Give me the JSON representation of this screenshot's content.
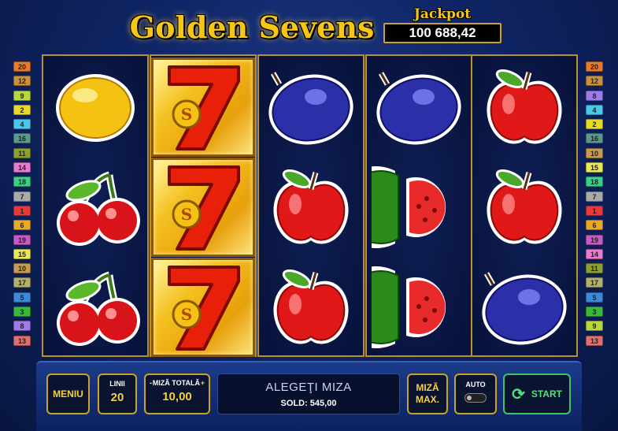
{
  "header": {
    "title": "Golden Sevens",
    "jackpot_label": "Jackpot",
    "jackpot_value": "100 688,42"
  },
  "paylines": {
    "left": [
      {
        "n": "20",
        "color": "#e87a2a"
      },
      {
        "n": "12",
        "color": "#c99040"
      },
      {
        "n": "9",
        "color": "#b7d83a"
      },
      {
        "n": "2",
        "color": "#e8d82a"
      },
      {
        "n": "4",
        "color": "#4ac8e8"
      },
      {
        "n": "16",
        "color": "#5a9a8a"
      },
      {
        "n": "11",
        "color": "#8aa030"
      },
      {
        "n": "14",
        "color": "#e87ad0"
      },
      {
        "n": "18",
        "color": "#3ad08a"
      },
      {
        "n": "7",
        "color": "#aaaaaa"
      },
      {
        "n": "1",
        "color": "#e83a3a"
      },
      {
        "n": "6",
        "color": "#e8a82a"
      },
      {
        "n": "19",
        "color": "#c85ac8"
      },
      {
        "n": "15",
        "color": "#e8e85a"
      },
      {
        "n": "10",
        "color": "#c89a50"
      },
      {
        "n": "17",
        "color": "#b0b070"
      },
      {
        "n": "5",
        "color": "#3a8ad8"
      },
      {
        "n": "3",
        "color": "#3ab83a"
      },
      {
        "n": "8",
        "color": "#a07ae8"
      },
      {
        "n": "13",
        "color": "#e07070"
      }
    ],
    "right": [
      {
        "n": "20",
        "color": "#e87a2a"
      },
      {
        "n": "12",
        "color": "#c99040"
      },
      {
        "n": "8",
        "color": "#a07ae8"
      },
      {
        "n": "4",
        "color": "#4ac8e8"
      },
      {
        "n": "2",
        "color": "#e8d82a"
      },
      {
        "n": "16",
        "color": "#5a9a8a"
      },
      {
        "n": "10",
        "color": "#c89a50"
      },
      {
        "n": "15",
        "color": "#e8e85a"
      },
      {
        "n": "18",
        "color": "#3ad08a"
      },
      {
        "n": "7",
        "color": "#aaaaaa"
      },
      {
        "n": "1",
        "color": "#e83a3a"
      },
      {
        "n": "6",
        "color": "#e8a82a"
      },
      {
        "n": "19",
        "color": "#c85ac8"
      },
      {
        "n": "14",
        "color": "#e87ad0"
      },
      {
        "n": "11",
        "color": "#8aa030"
      },
      {
        "n": "17",
        "color": "#b0b070"
      },
      {
        "n": "5",
        "color": "#3a8ad8"
      },
      {
        "n": "3",
        "color": "#3ab83a"
      },
      {
        "n": "9",
        "color": "#b7d83a"
      },
      {
        "n": "13",
        "color": "#e07070"
      }
    ]
  },
  "reels": [
    [
      "lemon",
      "cherry",
      "cherry"
    ],
    [
      "seven",
      "seven",
      "seven"
    ],
    [
      "plum",
      "apple",
      "apple"
    ],
    [
      "plum",
      "watermelon",
      "watermelon"
    ],
    [
      "apple",
      "apple",
      "plum"
    ]
  ],
  "controls": {
    "menu_label": "MENIU",
    "lines_label": "LINII",
    "lines_value": "20",
    "bet_minus": "-",
    "bet_label": "MIZĂ TOTALĂ",
    "bet_plus": "+",
    "bet_value": "10,00",
    "message": "ALEGEŢI MIZA",
    "balance": "SOLD: 545,00",
    "maxbet_line1": "MIZĂ",
    "maxbet_line2": "MAX.",
    "auto_label": "AUTO",
    "start_label": "START"
  },
  "colors": {
    "accent_gold": "#f5c518",
    "start_green": "#4ee27a",
    "background_blue": "#0f2464"
  }
}
